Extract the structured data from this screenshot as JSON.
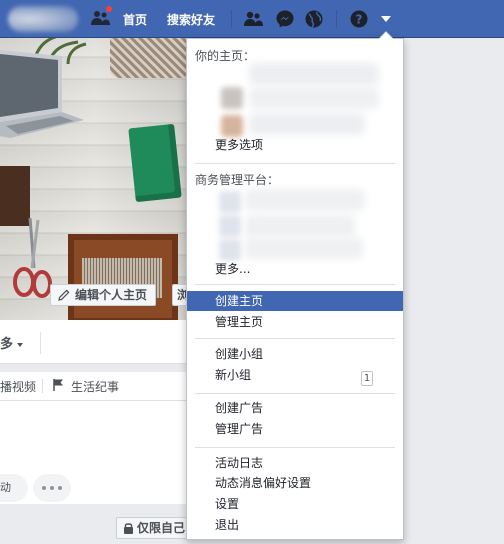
{
  "nav": {
    "home": "首页",
    "find_friends": "搜索好友",
    "icons": [
      "friend-requests-icon",
      "people-icon",
      "messenger-icon",
      "globe-icon",
      "help-icon",
      "caret-down-icon"
    ],
    "colors": {
      "bar": "#4267b2",
      "notification": "#fa3e3e"
    }
  },
  "cover": {
    "edit_profile": "编辑个人主页",
    "second_button_partial": "浏"
  },
  "profile_tabs": {
    "more": "多"
  },
  "composer": {
    "live_video": "播视频",
    "life_event": "生活纪事"
  },
  "actions": {
    "activity": "动",
    "privacy": "仅限自己"
  },
  "menu": {
    "your_pages_heading": "你的主页：",
    "more_options": "更多选项",
    "business_manager_heading": "商务管理平台：",
    "more": "更多...",
    "create_page": "创建主页",
    "manage_pages": "管理主页",
    "create_group": "创建小组",
    "new_groups": "新小组",
    "new_groups_count": "1",
    "create_ad": "创建广告",
    "manage_ads": "管理广告",
    "activity_log": "活动日志",
    "news_feed_preferences": "动态消息偏好设置",
    "settings": "设置",
    "logout": "退出",
    "highlight_color": "#4267b2"
  }
}
